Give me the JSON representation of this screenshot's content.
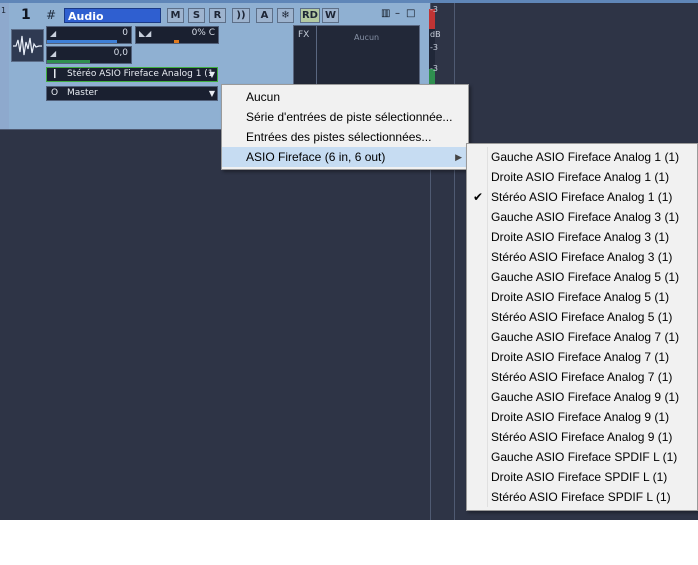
{
  "track": {
    "gutter_number": "1",
    "number": "1",
    "name": "Audio",
    "buttons": [
      "M",
      "S",
      "R",
      "))",
      "A",
      "❄",
      "RD",
      "W"
    ],
    "volume_value": "0",
    "pan_value": "0% C",
    "gain_value": "0,0",
    "input_value": "Stéréo ASIO Fireface Analog 1 (1",
    "output_value": "Master",
    "fx_label": "FX",
    "fx_empty": "Aucun",
    "meter_scale": [
      "-3",
      "dB",
      "-3",
      "-3"
    ]
  },
  "menu_input": {
    "items": [
      "Aucun",
      "Série d'entrées de piste sélectionnée...",
      "Entrées des pistes sélectionnées...",
      "ASIO Fireface (6 in, 6 out)"
    ]
  },
  "menu_device": {
    "items": [
      "Gauche ASIO Fireface Analog 1 (1)",
      "Droite ASIO Fireface Analog 1 (1)",
      "Stéréo ASIO Fireface Analog 1 (1)",
      "Gauche ASIO Fireface Analog 3 (1)",
      "Droite ASIO Fireface Analog 3 (1)",
      "Stéréo ASIO Fireface Analog 3 (1)",
      "Gauche ASIO Fireface Analog 5 (1)",
      "Droite ASIO Fireface Analog 5 (1)",
      "Stéréo ASIO Fireface Analog 5 (1)",
      "Gauche ASIO Fireface Analog 7 (1)",
      "Droite ASIO Fireface Analog 7 (1)",
      "Stéréo ASIO Fireface Analog 7 (1)",
      "Gauche ASIO Fireface Analog 9 (1)",
      "Droite ASIO Fireface Analog 9 (1)",
      "Stéréo ASIO Fireface Analog 9 (1)",
      "Gauche ASIO Fireface SPDIF L (1)",
      "Droite ASIO Fireface SPDIF L (1)",
      "Stéréo ASIO Fireface SPDIF L (1)"
    ],
    "checked_item": "Stéréo ASIO Fireface Analog 1 (1)"
  },
  "colors": {
    "background": "#2e3446",
    "track": "#8fb0d2",
    "name_field": "#2f5fd0",
    "menu": "#f1f1f1",
    "menu_highlight": "#c6dcf2",
    "input_border": "#3fae3f"
  },
  "icons": [
    "waveform-icon",
    "track-grid-icon",
    "menu-icon",
    "minimize-icon",
    "maximize-icon",
    "checkmark-icon",
    "submenu-arrow-icon",
    "dropdown-arrow-icon"
  ]
}
